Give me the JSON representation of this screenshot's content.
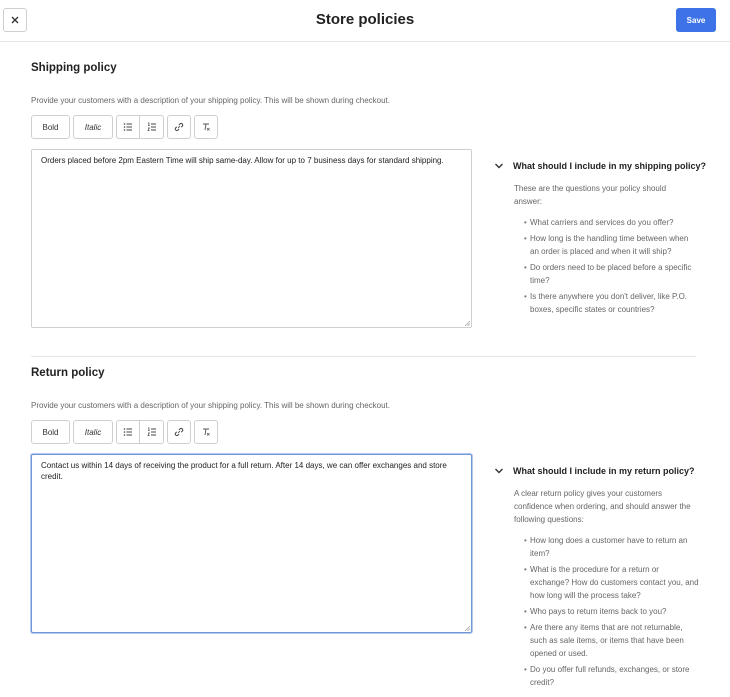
{
  "header": {
    "title": "Store policies",
    "save_label": "Save"
  },
  "toolbar": {
    "bold_label": "Bold",
    "italic_label": "Italic"
  },
  "shipping": {
    "title": "Shipping policy",
    "description": "Provide your customers with a description of your shipping policy. This will be shown during checkout.",
    "value": "Orders placed before 2pm Eastern Time will ship same-day. Allow for up to 7 business days for standard shipping.",
    "help_title": "What should I include in my shipping policy?",
    "help_intro": "These are the questions your policy should answer:",
    "help_items": [
      "What carriers and services do you offer?",
      "How long is the handling time between when an order is placed and when it will ship?",
      "Do orders need to be placed before a specific time?",
      "Is there anywhere you don't deliver, like P.O. boxes, specific states or countries?"
    ]
  },
  "returns": {
    "title": "Return policy",
    "description": "Provide your customers with a description of your shipping policy. This will be shown during checkout.",
    "value": "Contact us within 14 days of receiving the product for a full return. After 14 days, we can offer exchanges and store credit.",
    "help_title": "What should I include in my return policy?",
    "help_intro": "A clear return policy gives your customers confidence when ordering, and should answer the following questions:",
    "help_items": [
      "How long does a customer have to return an item?",
      "What is the procedure for a return or exchange? How do customers contact you, and how long will the process take?",
      "Who pays to return items back to you?",
      "Are there any items that are not returnable, such as sale items, or items that have been opened or used.",
      "Do you offer full refunds, exchanges, or store credit?"
    ]
  },
  "icons": {
    "close": "close-icon",
    "bulleted_list": "bulleted-list-icon",
    "numbered_list": "numbered-list-icon",
    "link": "link-icon",
    "clear_format": "clear-format-icon",
    "chevron": "chevron-down-icon"
  },
  "colors": {
    "accent": "#3e73e8",
    "focus_border": "#6f96d6"
  }
}
